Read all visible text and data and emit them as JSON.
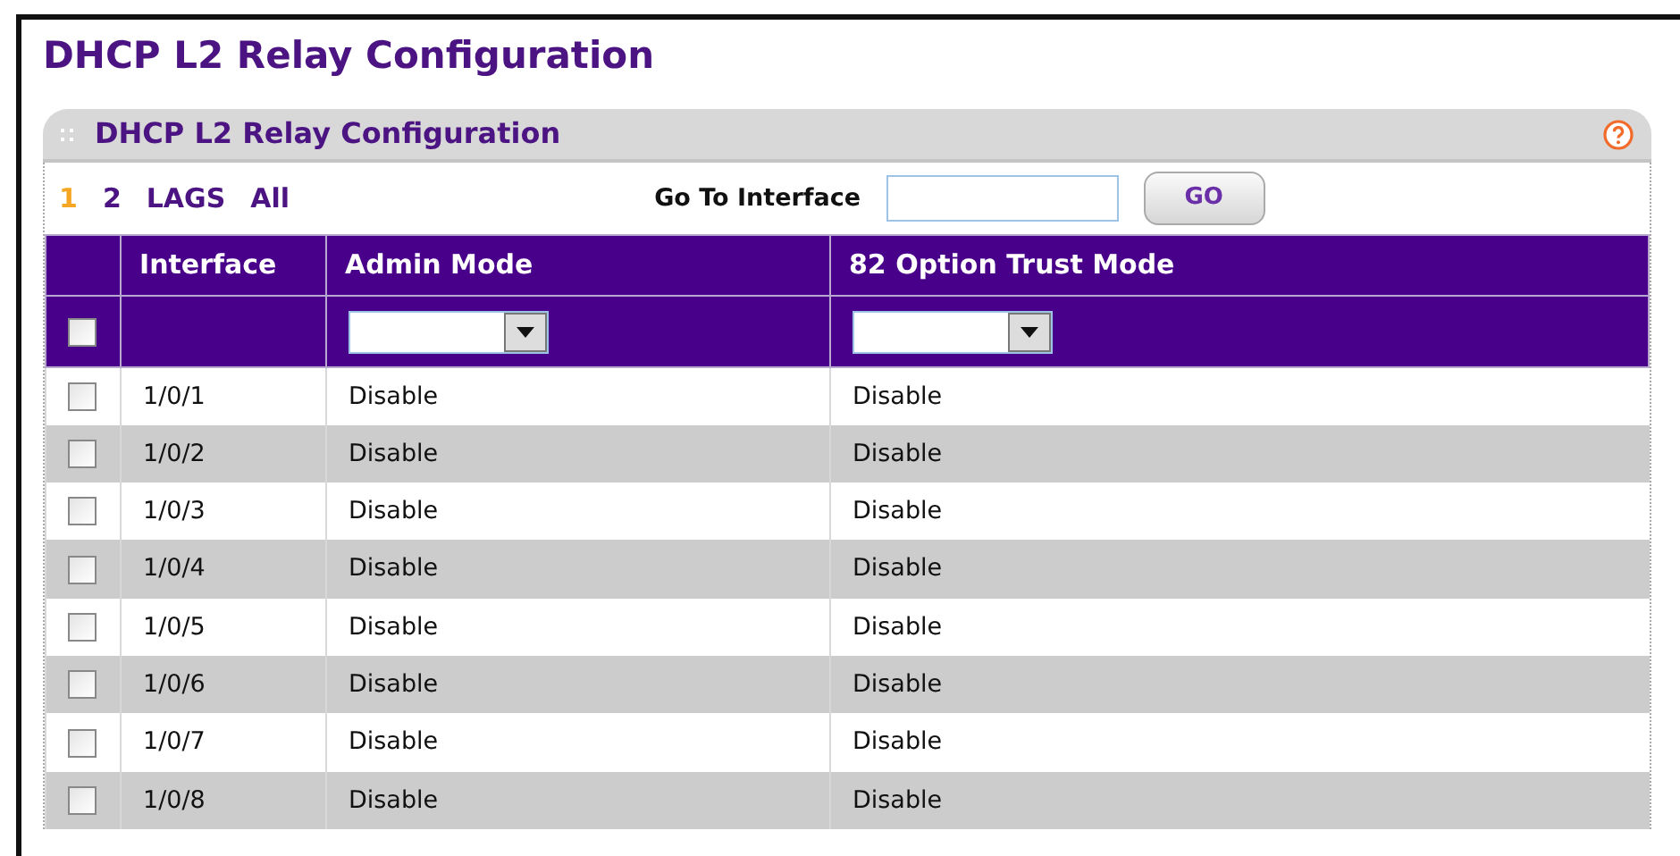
{
  "page_title": "DHCP L2 Relay Configuration",
  "panel": {
    "title": "DHCP L2 Relay Configuration",
    "pages": [
      {
        "label": "1",
        "selected": true
      },
      {
        "label": "2",
        "selected": false
      },
      {
        "label": "LAGS",
        "selected": false
      },
      {
        "label": "All",
        "selected": false
      }
    ],
    "go_to": {
      "label": "Go To Interface",
      "button": "GO"
    },
    "table": {
      "columns": [
        "Interface",
        "Admin Mode",
        "82 Option Trust Mode"
      ],
      "filter_row": {
        "checked": false
      },
      "rows": [
        {
          "checked": false,
          "interface": "1/0/1",
          "admin_mode": "Disable",
          "trust_mode": "Disable"
        },
        {
          "checked": false,
          "interface": "1/0/2",
          "admin_mode": "Disable",
          "trust_mode": "Disable"
        },
        {
          "checked": false,
          "interface": "1/0/3",
          "admin_mode": "Disable",
          "trust_mode": "Disable"
        },
        {
          "checked": false,
          "interface": "1/0/4",
          "admin_mode": "Disable",
          "trust_mode": "Disable"
        },
        {
          "checked": false,
          "interface": "1/0/5",
          "admin_mode": "Disable",
          "trust_mode": "Disable"
        },
        {
          "checked": false,
          "interface": "1/0/6",
          "admin_mode": "Disable",
          "trust_mode": "Disable"
        },
        {
          "checked": false,
          "interface": "1/0/7",
          "admin_mode": "Disable",
          "trust_mode": "Disable"
        },
        {
          "checked": false,
          "interface": "1/0/8",
          "admin_mode": "Disable",
          "trust_mode": "Disable"
        }
      ]
    }
  }
}
